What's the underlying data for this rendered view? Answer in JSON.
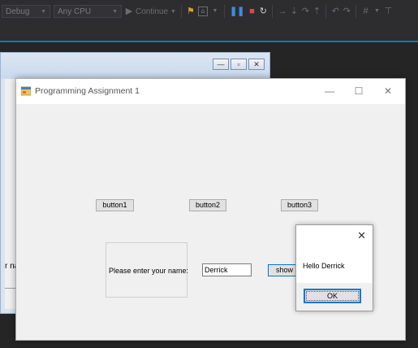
{
  "toolbar": {
    "config_label": "Debug",
    "platform_label": "Any CPU",
    "continue_label": "Continue"
  },
  "designer": {
    "partial_label": "r na"
  },
  "app": {
    "title": "Programming Assignment 1",
    "button1_label": "button1",
    "button2_label": "button2",
    "button3_label": "button3",
    "name_prompt": "Please enter your name:",
    "name_value": "Derrick",
    "show_button_label": "show n"
  },
  "dialog": {
    "message": "Hello Derrick",
    "ok_label": "OK"
  }
}
